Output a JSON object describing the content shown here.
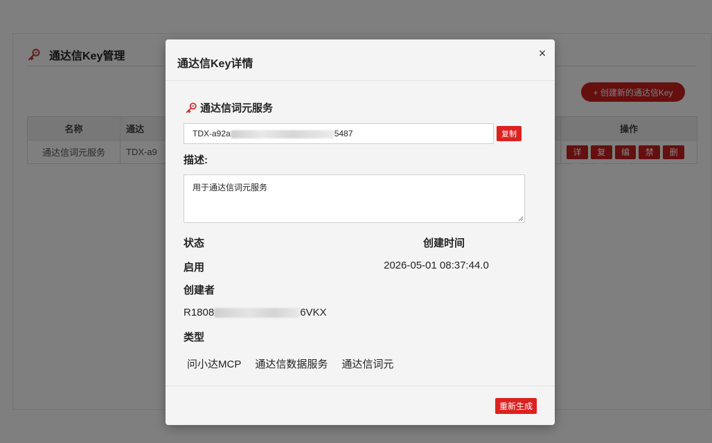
{
  "page": {
    "title": "通达信Key管理",
    "create_button": "+ 创建新的通达信Key",
    "table": {
      "headers": [
        "名称",
        "通达",
        "操作"
      ],
      "rows": [
        {
          "name": "通达信词元服务",
          "key": "TDX-a9"
        }
      ],
      "actions": [
        "详情",
        "复制",
        "编辑",
        "禁用",
        "删除"
      ]
    }
  },
  "modal": {
    "title": "通达信Key详情",
    "close_glyph": "×",
    "key_name": "通达信词元服务",
    "key_prefix": "TDX-a92a",
    "key_suffix": "5487",
    "copy_button": "复制",
    "description_label": "描述:",
    "description_value": "用于通达信词元服务",
    "status_label": "状态",
    "status_value": "启用",
    "created_time_label": "创建时间",
    "created_time_value": "2026-05-01 08:37:44.0",
    "creator_label": "创建者",
    "creator_prefix": "R1808",
    "creator_suffix": "6VKX",
    "type_label": "类型",
    "types": [
      "问小达MCP",
      "通达信数据服务",
      "通达信词元"
    ],
    "regenerate_button": "重新生成"
  },
  "colors": {
    "accent_red": "#dd2020",
    "button_red": "#c8201f",
    "overlay": "rgba(0,0,0,0.5)",
    "modal_bg": "#f4f4f4"
  },
  "icons": [
    "key-icon",
    "close-icon"
  ]
}
